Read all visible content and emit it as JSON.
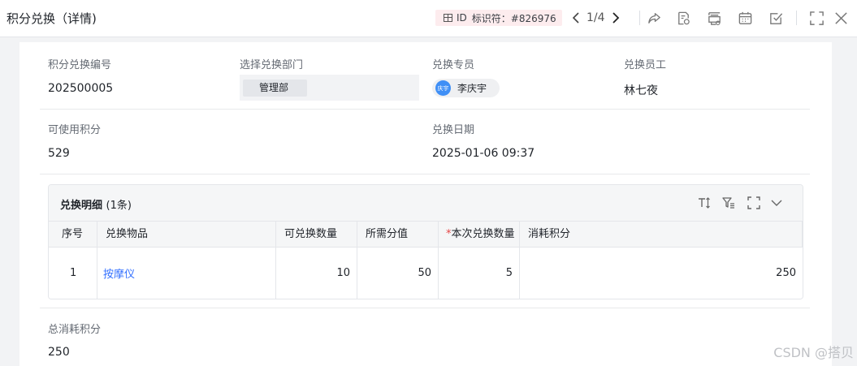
{
  "header": {
    "title": "积分兑换（详情)",
    "id_label": "ID",
    "id_text": "标识符：#826976",
    "pager": "1/4",
    "icons": [
      "prev-arrow-icon",
      "next-arrow-icon",
      "share-icon",
      "audit-icon",
      "print-icon",
      "calendar-icon",
      "checkbox-icon",
      "fullscreen-icon",
      "close-icon"
    ]
  },
  "form": {
    "exchange_no_label": "积分兑换编号",
    "exchange_no": "202500005",
    "dept_label": "选择兑换部门",
    "dept": "管理部",
    "agent_label": "兑换专员",
    "agent_avatar": "庆宇",
    "agent": "李庆宇",
    "employee_label": "兑换员工",
    "employee": "林七夜",
    "points_label": "可使用积分",
    "points": "529",
    "date_label": "兑换日期",
    "date": "2025-01-06 09:37"
  },
  "detail": {
    "title": "兑换明细",
    "count": "(1条)",
    "columns": [
      "序号",
      "兑换物品",
      "可兑换数量",
      "所需分值",
      "本次兑换数量",
      "消耗积分"
    ],
    "required_mark": "*",
    "rows": [
      {
        "index": "1",
        "item": "按摩仪",
        "available": "10",
        "cost": "50",
        "qty": "5",
        "consumed": "250"
      }
    ]
  },
  "total": {
    "label": "总消耗积分",
    "value": "250"
  },
  "watermark": "CSDN @搭贝",
  "colors": {
    "accent": "#3370ff",
    "avatar": "#3f8ff6",
    "badge_bg": "#fdecee",
    "required": "#e54545"
  }
}
